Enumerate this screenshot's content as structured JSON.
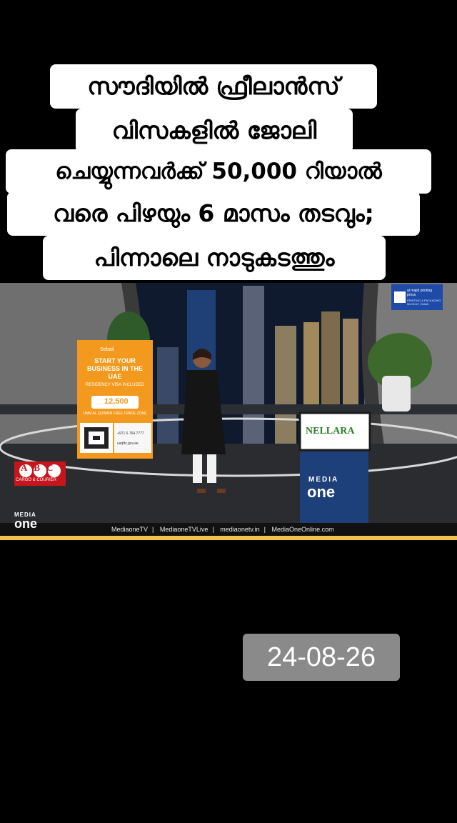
{
  "headline": {
    "lines": [
      "സൗദിയിൽ ഫ്രീലാൻസ്",
      "വിസകളിൽ ജോലി",
      "ചെയ്യുന്നവർക്ക് 50,000 റിയാൽ",
      "വരെ പിഴയും 6 മാസം തടവും;",
      "പിന്നാലെ നാടുകടത്തും"
    ]
  },
  "video": {
    "ad_panel": {
      "brand": "Sebail",
      "title": "START YOUR BUSINESS IN THE UAE",
      "subtitle": "RESIDENCY VISA INCLUDED",
      "price": "12,500",
      "note": "UMM AL QUWAIN FREE TRADE ZONE",
      "phone": "+971 6 764 7777",
      "web": "uaqftz.gov.ae"
    },
    "abc_logo": {
      "letters": "ABC",
      "sub": "CARGO & COURIER"
    },
    "nellara": "NELLARA",
    "al_majid": {
      "name": "al majid printing press",
      "sub": "PRINTING & PACKAGING MUSCAT, OMAN"
    },
    "channel_logo": {
      "top": "MEDIA",
      "bottom": "one"
    },
    "desk_logo": {
      "top": "MEDIA",
      "bottom": "one"
    },
    "social": [
      "MediaoneTV",
      "MediaoneTVLive",
      "mediaonetv.in",
      "MediaOneOnline.com"
    ],
    "separator": "|"
  },
  "date_badge": "24-08-26",
  "colors": {
    "accent_orange": "#f39a1e",
    "brand_red": "#c4161c",
    "nellara_green": "#2f7d2e"
  }
}
